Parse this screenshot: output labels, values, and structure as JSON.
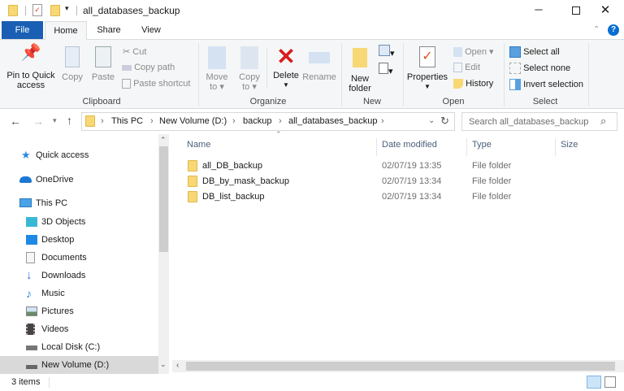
{
  "window": {
    "title": "all_databases_backup",
    "minimize_icon": "minimize-icon",
    "maximize_icon": "maximize-icon",
    "close_icon": "close-icon"
  },
  "tabs": [
    {
      "label": "File"
    },
    {
      "label": "Home"
    },
    {
      "label": "Share"
    },
    {
      "label": "View"
    }
  ],
  "ribbon": {
    "clipboard": {
      "label": "Clipboard",
      "pin": "Pin to Quick access",
      "pin1": "Pin to Quick",
      "pin2": "access",
      "copy": "Copy",
      "paste": "Paste",
      "cut": "Cut",
      "copy_path": "Copy path",
      "paste_shortcut": "Paste shortcut"
    },
    "organize": {
      "label": "Organize",
      "move1": "Move",
      "move2": "to",
      "copy1": "Copy",
      "copy2": "to",
      "delete": "Delete",
      "rename": "Rename"
    },
    "new": {
      "label": "New",
      "new1": "New",
      "new2": "folder"
    },
    "open": {
      "label": "Open",
      "properties": "Properties",
      "open": "Open",
      "edit": "Edit",
      "history": "History"
    },
    "select": {
      "label": "Select",
      "select_all": "Select all",
      "select_none": "Select none",
      "invert": "Invert selection"
    }
  },
  "address": {
    "crumbs": [
      "This PC",
      "New Volume (D:)",
      "backup",
      "all_databases_backup"
    ],
    "search_placeholder": "Search all_databases_backup"
  },
  "nav": {
    "quick_access": "Quick access",
    "onedrive": "OneDrive",
    "this_pc": "This PC",
    "items": [
      "3D Objects",
      "Desktop",
      "Documents",
      "Downloads",
      "Music",
      "Pictures",
      "Videos",
      "Local Disk (C:)",
      "New Volume (D:)"
    ],
    "selected": "New Volume (D:)"
  },
  "columns": [
    "Name",
    "Date modified",
    "Type",
    "Size"
  ],
  "files": [
    {
      "name": "all_DB_backup",
      "date": "02/07/19 13:35",
      "type": "File folder"
    },
    {
      "name": "DB_by_mask_backup",
      "date": "02/07/19 13:34",
      "type": "File folder"
    },
    {
      "name": "DB_list_backup",
      "date": "02/07/19 13:34",
      "type": "File folder"
    }
  ],
  "status": {
    "count": "3 items"
  },
  "colors": {
    "file_tab": "#1a5fb4",
    "folder": "#f8d775",
    "selected_nav": "#d9d9d9",
    "accent": "#0078d7"
  }
}
